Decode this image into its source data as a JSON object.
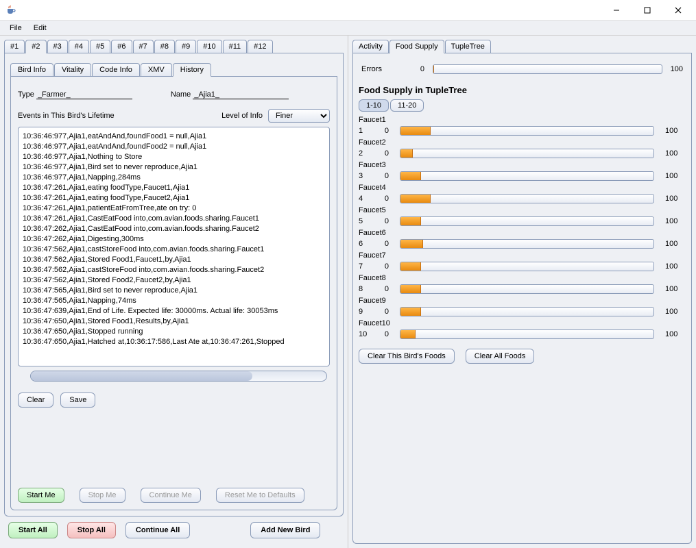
{
  "menu": {
    "file": "File",
    "edit": "Edit"
  },
  "numTabs": [
    "#1",
    "#2",
    "#3",
    "#4",
    "#5",
    "#6",
    "#7",
    "#8",
    "#9",
    "#10",
    "#11",
    "#12"
  ],
  "numTabActive": 1,
  "innerTabs": [
    "Bird Info",
    "Vitality",
    "Code Info",
    "XMV",
    "History"
  ],
  "innerTabActive": 4,
  "leftPanel": {
    "typeLabel": "Type",
    "typeValue": "_Farmer_",
    "nameLabel": "Name",
    "nameValue": "_Ajia1_",
    "eventsLabel": "Events in This Bird's Lifetime",
    "levelLabel": "Level of Info",
    "levelValue": "Finer",
    "clearBtn": "Clear",
    "saveBtn": "Save",
    "startMe": "Start Me",
    "stopMe": "Stop Me",
    "continueMe": "Continue Me",
    "resetMe": "Reset Me to Defaults"
  },
  "logLines": [
    "10:36:46:977,Ajia1,eatAndAnd,foundFood1 = null,Ajia1",
    "10:36:46:977,Ajia1,eatAndAnd,foundFood2 = null,Ajia1",
    "10:36:46:977,Ajia1,Nothing to Store",
    "10:36:46:977,Ajia1,Bird set to never reproduce,Ajia1",
    "10:36:46:977,Ajia1,Napping,284ms",
    "10:36:47:261,Ajia1,eating foodType,Faucet1,Ajia1",
    "10:36:47:261,Ajia1,eating foodType,Faucet2,Ajia1",
    "10:36:47:261,Ajia1,patientEatFromTree,ate on try: 0",
    "10:36:47:261,Ajia1,CastEatFood into,com.avian.foods.sharing.Faucet1",
    "10:36:47:262,Ajia1,CastEatFood into,com.avian.foods.sharing.Faucet2",
    "10:36:47:262,Ajia1,Digesting,300ms",
    "10:36:47:562,Ajia1,castStoreFood into,com.avian.foods.sharing.Faucet1",
    "10:36:47:562,Ajia1,Stored Food1,Faucet1,by,Ajia1",
    "10:36:47:562,Ajia1,castStoreFood into,com.avian.foods.sharing.Faucet2",
    "10:36:47:562,Ajia1,Stored Food2,Faucet2,by,Ajia1",
    "10:36:47:565,Ajia1,Bird set to never reproduce,Ajia1",
    "10:36:47:565,Ajia1,Napping,74ms",
    "10:36:47:639,Ajia1,End of Life. Expected life: 30000ms. Actual life: 30053ms",
    "10:36:47:650,Ajia1,Stored Food1,Results,by,Ajia1",
    "10:36:47:650,Ajia1,Stopped running",
    "10:36:47:650,Ajia1,Hatched at,10:36:17:586,Last Ate at,10:36:47:261,Stopped"
  ],
  "bottom": {
    "startAll": "Start All",
    "stopAll": "Stop All",
    "continueAll": "Continue All",
    "addNewBird": "Add New Bird"
  },
  "rightTabs": [
    "Activity",
    "Food Supply",
    "TupleTree"
  ],
  "rightTabActive": 1,
  "errors": {
    "label": "Errors",
    "value": "0",
    "max": "100",
    "pct": 0
  },
  "supplyTitle": "Food Supply in TupleTree",
  "rangeTabs": [
    "1-10",
    "11-20"
  ],
  "rangeActive": 0,
  "faucets": [
    {
      "label": "Faucet1",
      "idx": "1",
      "min": "0",
      "max": "100",
      "pct": 12
    },
    {
      "label": "Faucet2",
      "idx": "2",
      "min": "0",
      "max": "100",
      "pct": 5
    },
    {
      "label": "Faucet3",
      "idx": "3",
      "min": "0",
      "max": "100",
      "pct": 8
    },
    {
      "label": "Faucet4",
      "idx": "4",
      "min": "0",
      "max": "100",
      "pct": 12
    },
    {
      "label": "Faucet5",
      "idx": "5",
      "min": "0",
      "max": "100",
      "pct": 8
    },
    {
      "label": "Faucet6",
      "idx": "6",
      "min": "0",
      "max": "100",
      "pct": 9
    },
    {
      "label": "Faucet7",
      "idx": "7",
      "min": "0",
      "max": "100",
      "pct": 8
    },
    {
      "label": "Faucet8",
      "idx": "8",
      "min": "0",
      "max": "100",
      "pct": 8
    },
    {
      "label": "Faucet9",
      "idx": "9",
      "min": "0",
      "max": "100",
      "pct": 8
    },
    {
      "label": "Faucet10",
      "idx": "10",
      "min": "0",
      "max": "100",
      "pct": 6
    }
  ],
  "rightBtns": {
    "clearBird": "Clear This Bird's Foods",
    "clearAll": "Clear All Foods"
  }
}
